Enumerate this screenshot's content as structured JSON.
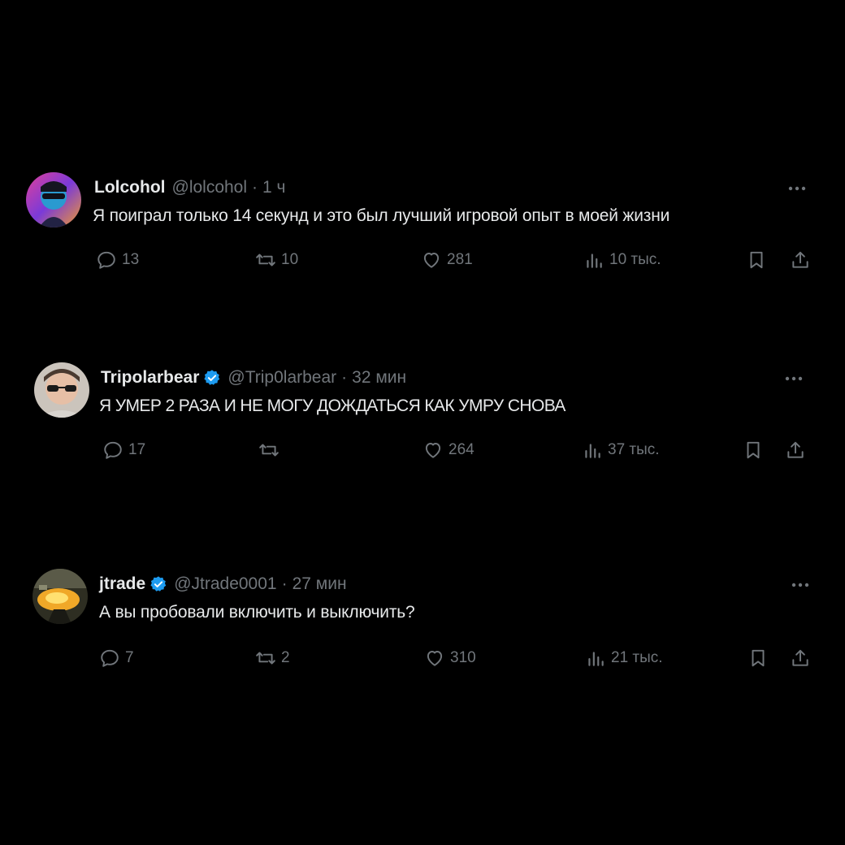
{
  "tweets": [
    {
      "name": "Lolcohol",
      "verified": false,
      "handle": "@lolcohol",
      "time": "1 ч",
      "text": "Я поиграл только 14 секунд и это был лучший игровой опыт в моей жизни",
      "replies": "13",
      "retweets": "10",
      "likes": "281",
      "views": "10 тыс.",
      "avatar_colors": [
        "#d83aa0",
        "#3a6ad8",
        "#f0a030"
      ]
    },
    {
      "name": "Tripolarbear",
      "verified": true,
      "handle": "@Trip0larbear",
      "time": "32 мин",
      "text": "Я УМЕР 2 РАЗА И НЕ МОГУ ДОЖДАТЬСЯ КАК УМРУ СНОВА",
      "replies": "17",
      "retweets": "",
      "likes": "264",
      "views": "37 тыс.",
      "avatar_colors": [
        "#cfc7c0",
        "#e8c0a8",
        "#222222"
      ]
    },
    {
      "name": "jtrade",
      "verified": true,
      "handle": "@Jtrade0001",
      "time": "27 мин",
      "text": "А вы пробовали включить и выключить?",
      "replies": "7",
      "retweets": "2",
      "likes": "310",
      "views": "21 тыс.",
      "avatar_colors": [
        "#3a3a2a",
        "#f2b02a",
        "#8a6a30"
      ]
    }
  ],
  "separator": "·",
  "colors": {
    "background": "#000000",
    "text": "#e7e9ea",
    "muted": "#71767b",
    "verified": "#1d9bf0"
  }
}
